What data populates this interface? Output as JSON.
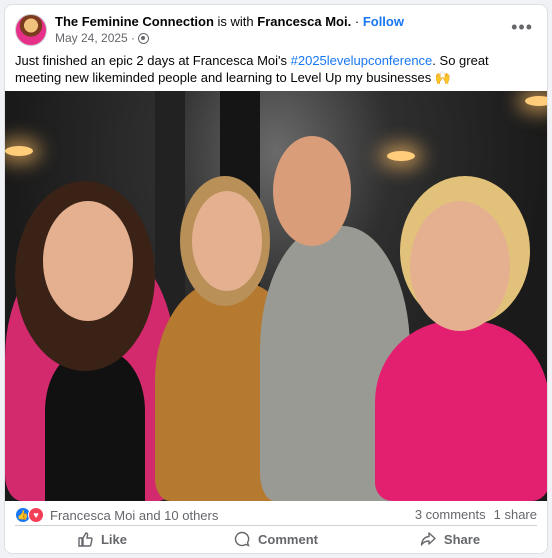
{
  "post": {
    "author": "The Feminine Connection",
    "is_with_text": "is with",
    "tagged": "Francesca Moi.",
    "dot": "·",
    "follow": "Follow",
    "date": "May 24, 2025 ·",
    "text_before": "Just finished an epic 2 days at Francesca Moi's ",
    "hashtag": "#2025levelupconference",
    "text_after": ". So great meeting new likeminded people and learning to Level Up my businesses 🙌",
    "more": "•••"
  },
  "stats": {
    "reactions": "Francesca Moi and 10 others",
    "comments": "3 comments",
    "shares": "1 share"
  },
  "actions": {
    "like": "Like",
    "comment": "Comment",
    "share": "Share"
  },
  "icons": {
    "avatar": "profile-picture",
    "privacy": "globe-icon",
    "more": "more-options-icon",
    "like_reaction": "like-reaction-icon",
    "love_reaction": "love-reaction-icon",
    "like_action": "thumbs-up-icon",
    "comment_action": "comment-bubble-icon",
    "share_action": "share-arrow-icon"
  }
}
